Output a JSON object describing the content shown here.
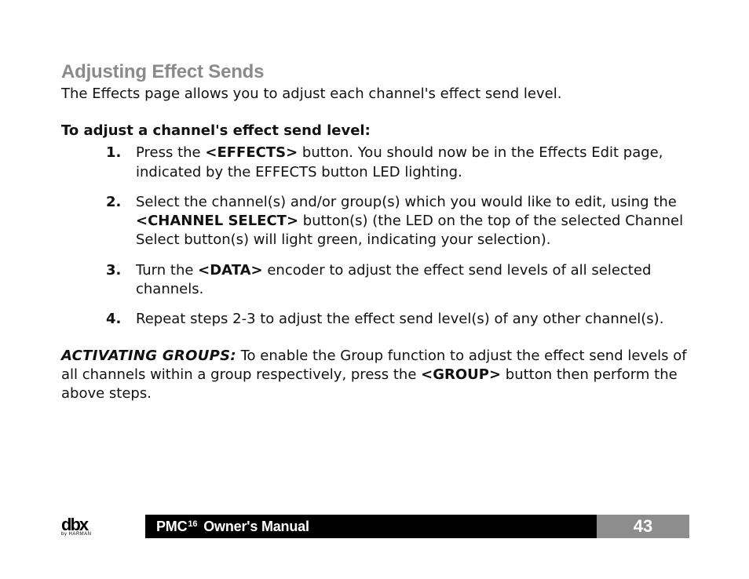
{
  "heading": "Adjusting Effect Sends",
  "intro": "The Effects page allows you to adjust each channel's effect send level.",
  "subhead": "To adjust a channel's effect send level:",
  "steps": {
    "n1": "1.",
    "s1a": "Press the ",
    "s1b": "<EFFECTS>",
    "s1c": " button. You should now be in the Effects Edit page, indicated by the EFFECTS button LED lighting.",
    "n2": "2.",
    "s2a": "Select the channel(s) and/or group(s) which you would like to edit, using the ",
    "s2b": "<CHANNEL SELECT>",
    "s2c": " button(s) (the LED on the top of the selected Channel Select button(s) will light green, indicating your selection).",
    "n3": "3.",
    "s3a": "Turn the ",
    "s3b": "<DATA>",
    "s3c": " encoder to adjust the effect send levels of all selected channels.",
    "n4": "4.",
    "s4": "Repeat steps 2-3 to adjust the effect send level(s) of any other channel(s)."
  },
  "callout": {
    "label": "ACTIVATING GROUPS:",
    "a": " To enable the Group function to adjust the effect send levels of all channels within a group respectively, press the ",
    "b": "<GROUP>",
    "c": " button then perform the above steps."
  },
  "footer": {
    "pmc": "PMC",
    "sup": "16",
    "owners_manual": "Owner's Manual",
    "page": "43",
    "logo_main": "dbx",
    "logo_sub": "by HARMAN"
  }
}
